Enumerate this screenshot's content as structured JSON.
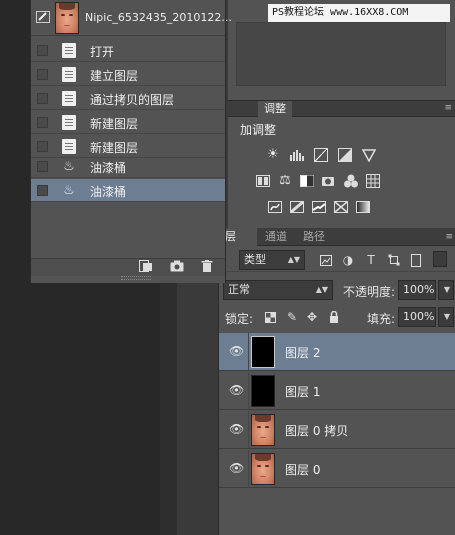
{
  "watermark": {
    "text": "PS教程论坛 www.16XX8.COM"
  },
  "history": {
    "snapshot_name": "Nipic_6532435_2010122...",
    "items": [
      {
        "label": "打开",
        "icon": "document-icon"
      },
      {
        "label": "建立图层",
        "icon": "document-icon"
      },
      {
        "label": "通过拷贝的图层",
        "icon": "document-icon"
      },
      {
        "label": "新建图层",
        "icon": "document-icon"
      },
      {
        "label": "新建图层",
        "icon": "document-icon"
      },
      {
        "label": "油漆桶",
        "icon": "paint-bucket-icon"
      },
      {
        "label": "油漆桶",
        "icon": "paint-bucket-icon",
        "selected": true
      }
    ]
  },
  "adjustments": {
    "tab_label": "调整",
    "add_label": "加调整",
    "panel_menu": "≡"
  },
  "layers": {
    "tabs": [
      "层",
      "通道",
      "路径"
    ],
    "filter_label": "类型",
    "blend_mode": "正常",
    "opacity_label": "不透明度:",
    "opacity_value": "100%",
    "lock_label": "锁定:",
    "fill_label": "填充:",
    "fill_value": "100%",
    "rows": [
      {
        "name": "图层 2",
        "thumb": "black",
        "selected": true
      },
      {
        "name": "图层 1",
        "thumb": "black"
      },
      {
        "name": "图层 0 拷贝",
        "thumb": "face"
      },
      {
        "name": "图层 0",
        "thumb": "face"
      }
    ]
  },
  "colors": {
    "selection": "#6d7d92",
    "panel": "#535353",
    "workspace": "#282828"
  }
}
